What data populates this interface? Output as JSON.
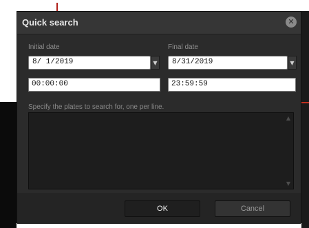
{
  "dialog": {
    "title": "Quick search",
    "close_icon": "close-icon"
  },
  "initial": {
    "label": "Initial date",
    "date": "8/ 1/2019",
    "time": "00:00:00"
  },
  "final": {
    "label": "Final date",
    "date": "8/31/2019",
    "time": "23:59:59"
  },
  "plates": {
    "instructions": "Specify the plates to search for, one per line.",
    "value": ""
  },
  "buttons": {
    "ok": "OK",
    "cancel": "Cancel"
  }
}
